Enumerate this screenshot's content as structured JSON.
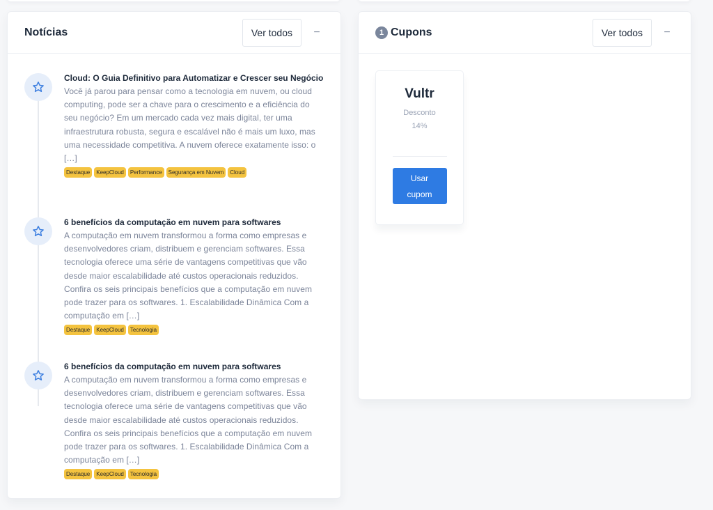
{
  "news": {
    "title": "Notícias",
    "view_all_label": "Ver todos",
    "collapse_symbol": "−",
    "items": [
      {
        "title": "Cloud: O Guia Definitivo para Automatizar e Crescer seu Negócio",
        "text": "Você já parou para pensar como a tecnologia em nuvem, ou cloud computing, pode ser a chave para o crescimento e a eficiência do seu negócio? Em um mercado cada vez mais digital, ter uma infraestrutura robusta, segura e escalável não é mais um luxo, mas uma necessidade competitiva. A nuvem oferece exatamente isso: o […]",
        "tags": [
          "Destaque",
          "KeepCloud",
          "Performance",
          "Segurança em Nuvem",
          "Cloud"
        ]
      },
      {
        "title": "6 benefícios da computação em nuvem para softwares",
        "text": "A computação em nuvem transformou a forma como empresas e desenvolvedores criam, distribuem e gerenciam softwares. Essa tecnologia oferece uma série de vantagens competitivas que vão desde maior escalabilidade até custos operacionais reduzidos. Confira os seis principais benefícios que a computação em nuvem pode trazer para os softwares. 1. Escalabilidade Dinâmica Com a computação em […]",
        "tags": [
          "Destaque",
          "KeepCloud",
          "Tecnologia"
        ]
      },
      {
        "title": "6 benefícios da computação em nuvem para softwares",
        "text": "A computação em nuvem transformou a forma como empresas e desenvolvedores criam, distribuem e gerenciam softwares. Essa tecnologia oferece uma série de vantagens competitivas que vão desde maior escalabilidade até custos operacionais reduzidos. Confira os seis principais benefícios que a computação em nuvem pode trazer para os softwares. 1. Escalabilidade Dinâmica Com a computação em […]",
        "tags": [
          "Destaque",
          "KeepCloud",
          "Tecnologia"
        ]
      }
    ]
  },
  "coupons": {
    "count": "1",
    "title": "Cupons",
    "view_all_label": "Ver todos",
    "collapse_symbol": "−",
    "items": [
      {
        "name": "Vultr",
        "discount_label": "Desconto",
        "discount_value": "14%",
        "button_line1": "Usar",
        "button_line2": "cupom"
      }
    ]
  },
  "colors": {
    "accent": "#2e7be3",
    "tag": "#f4c33f",
    "icon_bg": "#e6eefa"
  },
  "icons": {
    "timeline": "star-icon"
  }
}
